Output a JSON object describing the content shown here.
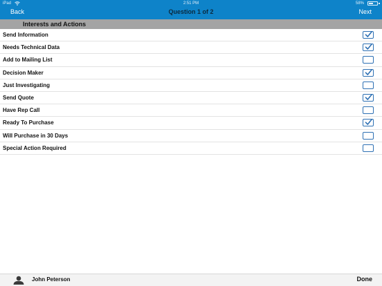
{
  "status_bar": {
    "carrier": "iPad",
    "time": "2:51 PM",
    "battery": "58%",
    "battery_level": 0.58,
    "wifi_icon": "wifi-icon",
    "battery_icon": "battery-icon"
  },
  "nav": {
    "back_label": "Back",
    "title": "Question 1 of 2",
    "next_label": "Next"
  },
  "section": {
    "title": "Interests and Actions"
  },
  "items": [
    {
      "label": "Send Information",
      "checked": true
    },
    {
      "label": "Needs Technical Data",
      "checked": true
    },
    {
      "label": "Add to Mailing List",
      "checked": false
    },
    {
      "label": "Decision Maker",
      "checked": true
    },
    {
      "label": "Just Investigating",
      "checked": false
    },
    {
      "label": "Send Quote",
      "checked": true
    },
    {
      "label": "Have Rep Call",
      "checked": false
    },
    {
      "label": "Ready To Purchase",
      "checked": true
    },
    {
      "label": "Will Purchase in 30 Days",
      "checked": false
    },
    {
      "label": "Special Action Required",
      "checked": false
    }
  ],
  "footer": {
    "user_icon": "user-icon",
    "user_name": "John Peterson",
    "done_label": "Done"
  },
  "colors": {
    "nav_background": "#0e83c9",
    "nav_title": "#0b2a3f",
    "section_background": "#a4a4a4",
    "checkbox_border": "#2c6fb3",
    "checkmark": "#2c6fb3",
    "footer_background": "#f3f3f3"
  }
}
